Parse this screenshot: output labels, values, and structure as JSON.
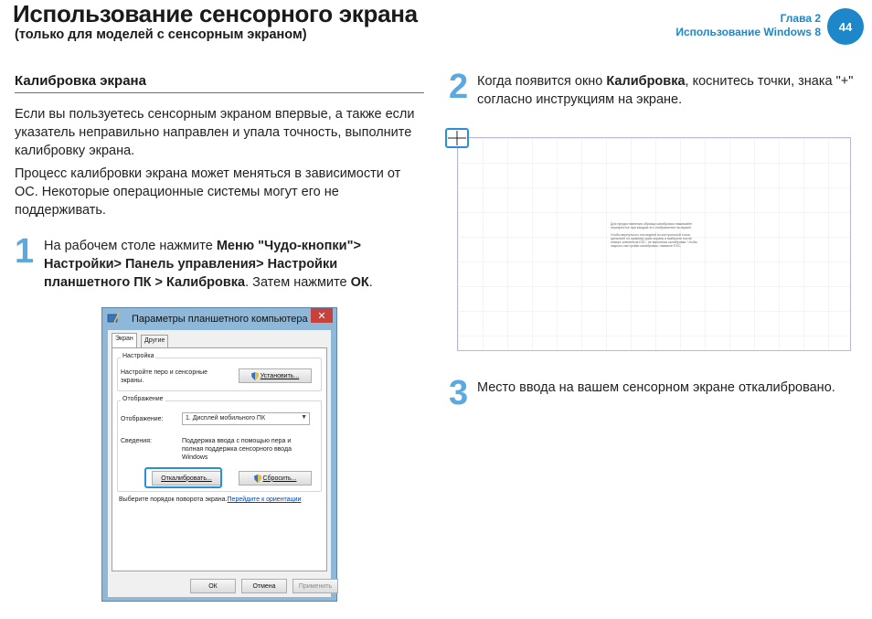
{
  "header": {
    "title": "Использование сенсорного экрана",
    "subtitle": "(только для моделей с сенсорным экраном)",
    "chapter_label": "Глава 2",
    "chapter_title": "Использование Windows 8",
    "page_number": "44"
  },
  "section": {
    "heading": "Калибровка экрана",
    "paragraph_1": "Если вы пользуетесь сенсорным экраном впервые, а также если указатель неправильно направлен и упала точность, выполните калибровку экрана.",
    "paragraph_2": "Процесс калибровки экрана может меняться в зависимости от ОС. Некоторые операционные системы могут его не поддерживать."
  },
  "steps": {
    "step1": {
      "number": "1",
      "t1": "На рабочем столе нажмите ",
      "b1": "Меню \"Чудо-кнопки\"> Настройки> Панель управления> Настройки планшетного ПК > Калибровка",
      "t2": ". Затем нажмите ",
      "b2": "ОК",
      "t3": "."
    },
    "step2": {
      "number": "2",
      "t1": "Когда появится окно ",
      "b1": "Калибровка",
      "t2": ", коснитесь точки, знака \"+\" согласно инструкциям на экране."
    },
    "step3": {
      "number": "3",
      "text": "Место ввода на вашем сенсорном экране откалибровано."
    }
  },
  "dialog": {
    "title": "Параметры планшетного компьютера",
    "close_glyph": "✕",
    "tabs": [
      "Экран",
      "Другие"
    ],
    "group_settings": "Настройка",
    "settings_text": "Настройте перо и сенсорные экраны.",
    "setup_button": "Установить...",
    "group_display": "Отображение",
    "display_label": "Отображение:",
    "display_value": "1. Дисплей мобильного ПК",
    "info_label": "Сведения:",
    "info_text": "Поддержка ввода с помощью пера и полная поддержка сенсорного ввода Windows",
    "calibrate_button": "Откалибровать...",
    "reset_button": "Сбросить...",
    "rotation_text": "Выберите порядок поворота экрана.",
    "rotation_link": "Перейдите к ориентации",
    "ok_button": "ОК",
    "cancel_button": "Отмена",
    "apply_button": "Применить"
  },
  "calibration": {
    "instructions_1": "Для предоставления образца калибровки нажимайте перекрестье при каждом его отображении на экране.",
    "instructions_2": "Чтобы вернуться к последней из контрольной точки, щёлкните по правому краю экрана и выберите после поверх элементов ESC, не выполняя калибровки. Чтобы закрыть настройки калибровки, нажмите ESC."
  },
  "colors": {
    "accent": "#1d87c9",
    "step_number": "#5aa9e0",
    "highlight": "#2c8fd6"
  }
}
